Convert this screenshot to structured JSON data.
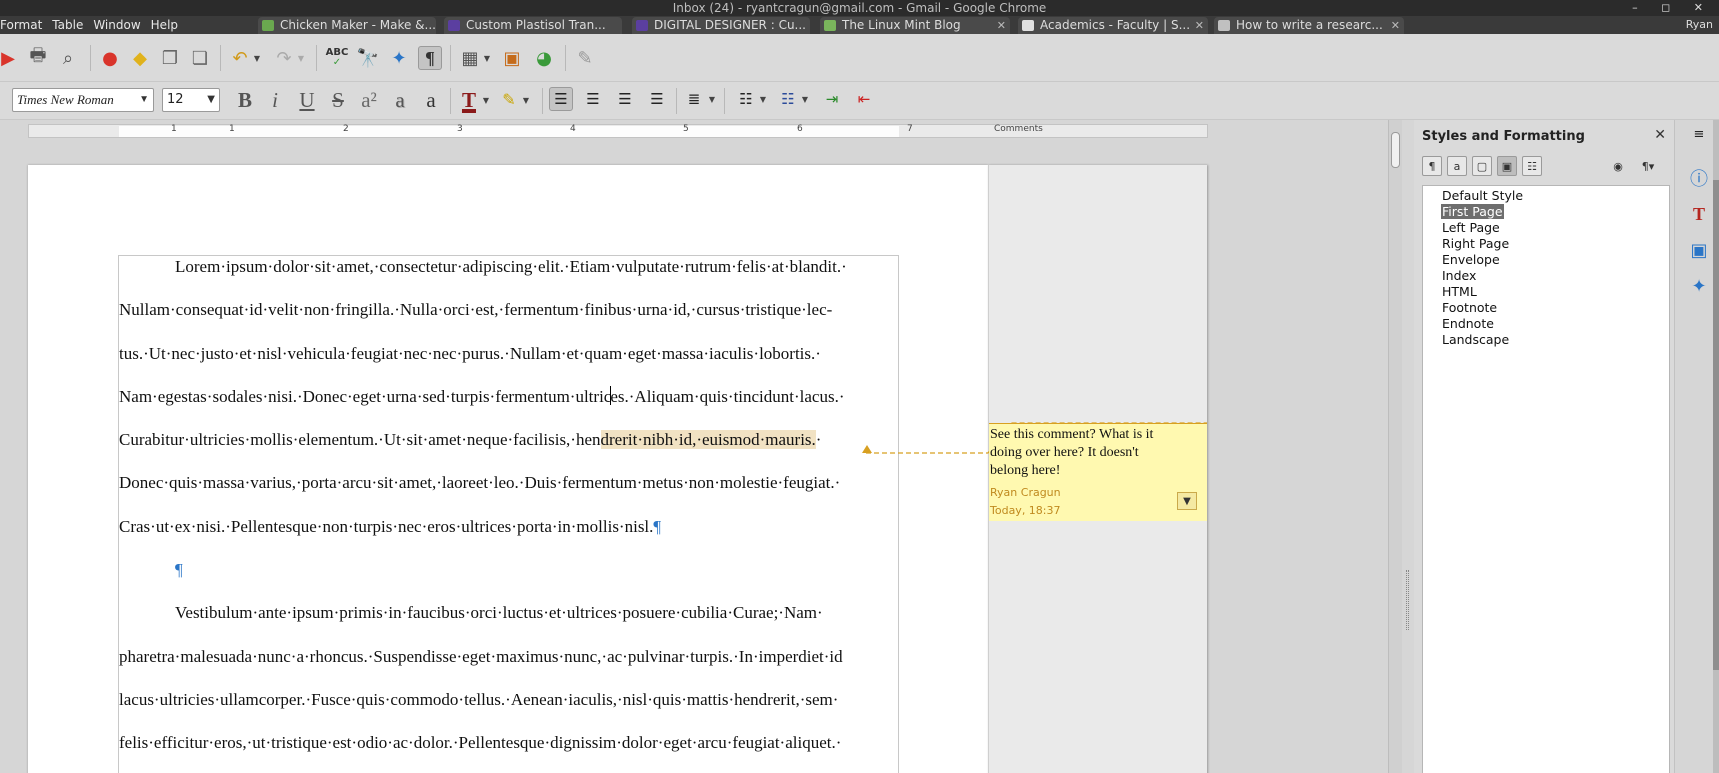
{
  "window": {
    "title": "Inbox (24) - ryantcragun@gmail.com - Gmail - Google Chrome",
    "controls": "– ◻ ✕"
  },
  "overlay_menu": [
    "Format",
    "Table",
    "Window",
    "Help"
  ],
  "browser_tabs": [
    {
      "label": "Chicken Maker - Make &...",
      "color": "#6aa84f"
    },
    {
      "label": "Custom Plastisol Tran...",
      "color": "#5b3fa0"
    },
    {
      "label": "DIGITAL DESIGNER : Cu...",
      "color": "#5b3fa0"
    },
    {
      "label": "The Linux Mint Blog",
      "color": "#7ab55c"
    },
    {
      "label": "Academics - Faculty | S...",
      "color": "#e0e0e0"
    },
    {
      "label": "How to write a researc...",
      "color": "#c0c0c0"
    }
  ],
  "browser_profile": "Ryan",
  "toolbar": {
    "font_name": "Times New Roman",
    "font_size": "12",
    "bold_glyph": "B",
    "italic_glyph": "i",
    "underline_glyph": "U",
    "strike_glyph": "S",
    "shadow_glyph": "a",
    "outline_glyph": "a",
    "plain_glyph": "a",
    "spellcheck_label": "ABC",
    "formatting_marks_glyph": "¶"
  },
  "ruler": {
    "numbers": [
      "1",
      "1",
      "2",
      "3",
      "4",
      "5",
      "6",
      "7"
    ],
    "comments_label": "Comments"
  },
  "document": {
    "paragraph1_lines": [
      "Lorem·ipsum·dolor·sit·amet,·consectetur·adipiscing·elit.·Etiam·vulputate·rutrum·felis·at·blandit.·",
      "Nullam·consequat·id·velit·non·fringilla.·Nulla·orci·est,·fermentum·finibus·urna·id,·cursus·tristique·lec-",
      "tus.·Ut·nec·justo·et·nisl·vehicula·feugiat·nec·nec·purus.·Nullam·et·quam·eget·massa·iaculis·lobortis.·"
    ],
    "line4_before_caret": "Nam·egestas·sodales·nisi.·Donec·eget·urna·sed·turpis·fermentum·ultric",
    "line4_after_caret": "es.·Aliquam·quis·tincidunt·lacus.·",
    "line5_before_highlight": "Curabitur·ultricies·mollis·elementum.·Ut·sit·amet·neque·facilisis,·hen",
    "line5_highlight": "drerit·nibh·id,·euismod·mauris.",
    "line5_after": "·",
    "paragraph1_rest": [
      "Donec·quis·massa·varius,·porta·arcu·sit·amet,·laoreet·leo.·Duis·fermentum·metus·non·molestie·feugiat.·",
      "Cras·ut·ex·nisi.·Pellentesque·non·turpis·nec·eros·ultrices·porta·in·mollis·nisl."
    ],
    "pilcrow": "¶",
    "paragraph2_lines": [
      "Vestibulum·ante·ipsum·primis·in·faucibus·orci·luctus·et·ultrices·posuere·cubilia·Curae;·Nam·",
      "pharetra·malesuada·nunc·a·rhoncus.·Suspendisse·eget·maximus·nunc,·ac·pulvinar·turpis.·In·imperdiet·id",
      "lacus·ultricies·ullamcorper.·Fusce·quis·commodo·tellus.·Aenean·iaculis,·nisl·quis·mattis·hendrerit,·sem·",
      "felis·efficitur·eros,·ut·tristique·est·odio·ac·dolor.·Pellentesque·dignissim·dolor·eget·arcu·feugiat·aliquet.·"
    ]
  },
  "comment": {
    "text": "See this comment? What is it doing over here? It doesn't belong here!",
    "author": "Ryan Cragun",
    "date": "Today, 18:37",
    "accent_color": "#d8a021",
    "background_color": "#fff9b0"
  },
  "sidebar": {
    "title": "Styles and Formatting",
    "styles": [
      "Default Style",
      "First Page",
      "Left Page",
      "Right Page",
      "Envelope",
      "Index",
      "HTML",
      "Footnote",
      "Endnote",
      "Landscape"
    ],
    "selected_style": "First Page"
  }
}
